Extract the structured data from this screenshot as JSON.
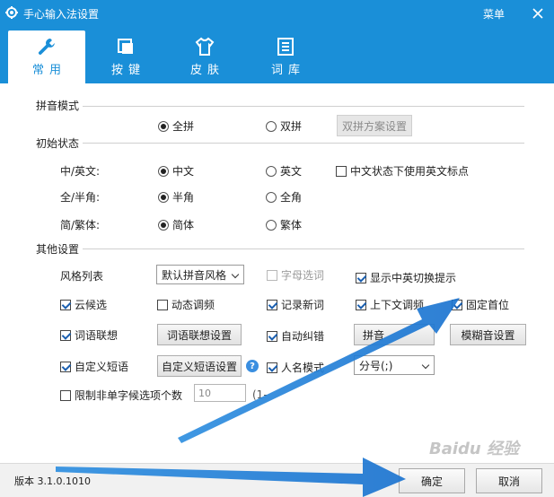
{
  "window": {
    "title": "手心输入法设置",
    "menu_label": "菜单",
    "accent_color": "#1a8fd8"
  },
  "tabs": [
    {
      "label": "常用",
      "icon": "wrench-icon",
      "active": true
    },
    {
      "label": "按键",
      "icon": "keyboard-icon",
      "active": false
    },
    {
      "label": "皮肤",
      "icon": "shirt-icon",
      "active": false
    },
    {
      "label": "词库",
      "icon": "list-icon",
      "active": false
    }
  ],
  "pinyin_mode": {
    "title": "拼音模式",
    "full_label": "全拼",
    "full_selected": true,
    "double_label": "双拼",
    "double_selected": false,
    "scheme_button": "双拼方案设置"
  },
  "initial_state": {
    "title": "初始状态",
    "rows": [
      {
        "label": "中/英文:",
        "opt1": "中文",
        "opt2": "英文",
        "selected": 1
      },
      {
        "label": "全/半角:",
        "opt1": "半角",
        "opt2": "全角",
        "selected": 1
      },
      {
        "label": "简/繁体:",
        "opt1": "简体",
        "opt2": "繁体",
        "selected": 1
      }
    ],
    "english_punct_label": "中文状态下使用英文标点",
    "english_punct_checked": false
  },
  "other": {
    "title": "其他设置",
    "style_label": "风格列表",
    "style_value": "默认拼音风格",
    "letter_select": {
      "label": "字母选词",
      "checked": false,
      "enabled": false
    },
    "show_switch_hint": {
      "label": "显示中英切换提示",
      "checked": true
    },
    "cloud_candidate": {
      "label": "云候选",
      "checked": true
    },
    "dynamic_freq": {
      "label": "动态调频",
      "checked": false
    },
    "record_new_words": {
      "label": "记录新词",
      "checked": true
    },
    "context_freq": {
      "label": "上下文调频",
      "checked": true
    },
    "fixed_first": {
      "label": "固定首位",
      "checked": true
    },
    "word_assoc": {
      "label": "词语联想",
      "checked": true
    },
    "word_assoc_button": "词语联想设置",
    "auto_correct": {
      "label": "自动纠错",
      "checked": true
    },
    "pinyin_button": "拼音",
    "fuzzy_button": "模糊音设置",
    "custom_phrase": {
      "label": "自定义短语",
      "checked": true
    },
    "custom_phrase_button": "自定义短语设置",
    "name_mode": {
      "label": "人名模式",
      "checked": true
    },
    "punct_select_value": "分号(;)",
    "limit_candidates": {
      "label": "限制非单字候选项个数",
      "checked": false
    },
    "limit_value": "10",
    "limit_range": "(1-"
  },
  "footer": {
    "version": "版本 3.1.0.1010",
    "ok_label": "确定",
    "cancel_label": "取消"
  },
  "watermark_text": "Baidu 经验"
}
